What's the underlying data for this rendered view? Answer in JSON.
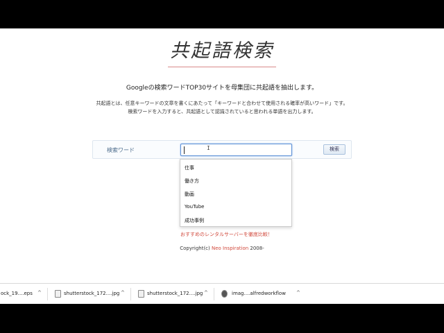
{
  "page": {
    "logo": "共起語検索",
    "subtitle": "Googleの検索ワードTOP30サイトを母集団に共起語を抽出します。",
    "description_line1": "共起語とは、任意キーワードの文章を書くにあたって「キーワードと合わせて使用される確率が高いワード」です。",
    "description_line2": "検索ワードを入力すると、共起語として認識されていると思われる単語を出力します。"
  },
  "search": {
    "label": "検索ワード",
    "value": "",
    "button_label": "検索"
  },
  "suggestions": [
    "仕事",
    "働き方",
    "動画",
    "YouTube",
    "成功事例"
  ],
  "promo_link": "おすすめのレンタルサーバーを徹底比較！",
  "footer": {
    "copyright_prefix": "Copyright(c) ",
    "brand": "Neo Inspiration",
    "year": " 2008-"
  },
  "downloads": [
    {
      "name": "ock_19....eps"
    },
    {
      "name": "shutterstock_172....jpg"
    },
    {
      "name": "shutterstock_172....jpg"
    },
    {
      "name": "imag....alfredworkflow"
    }
  ],
  "icons": {
    "chevron": "^",
    "ibeam": "I"
  },
  "colors": {
    "accent": "#d0473a",
    "input_focus": "#5b8fd6"
  }
}
